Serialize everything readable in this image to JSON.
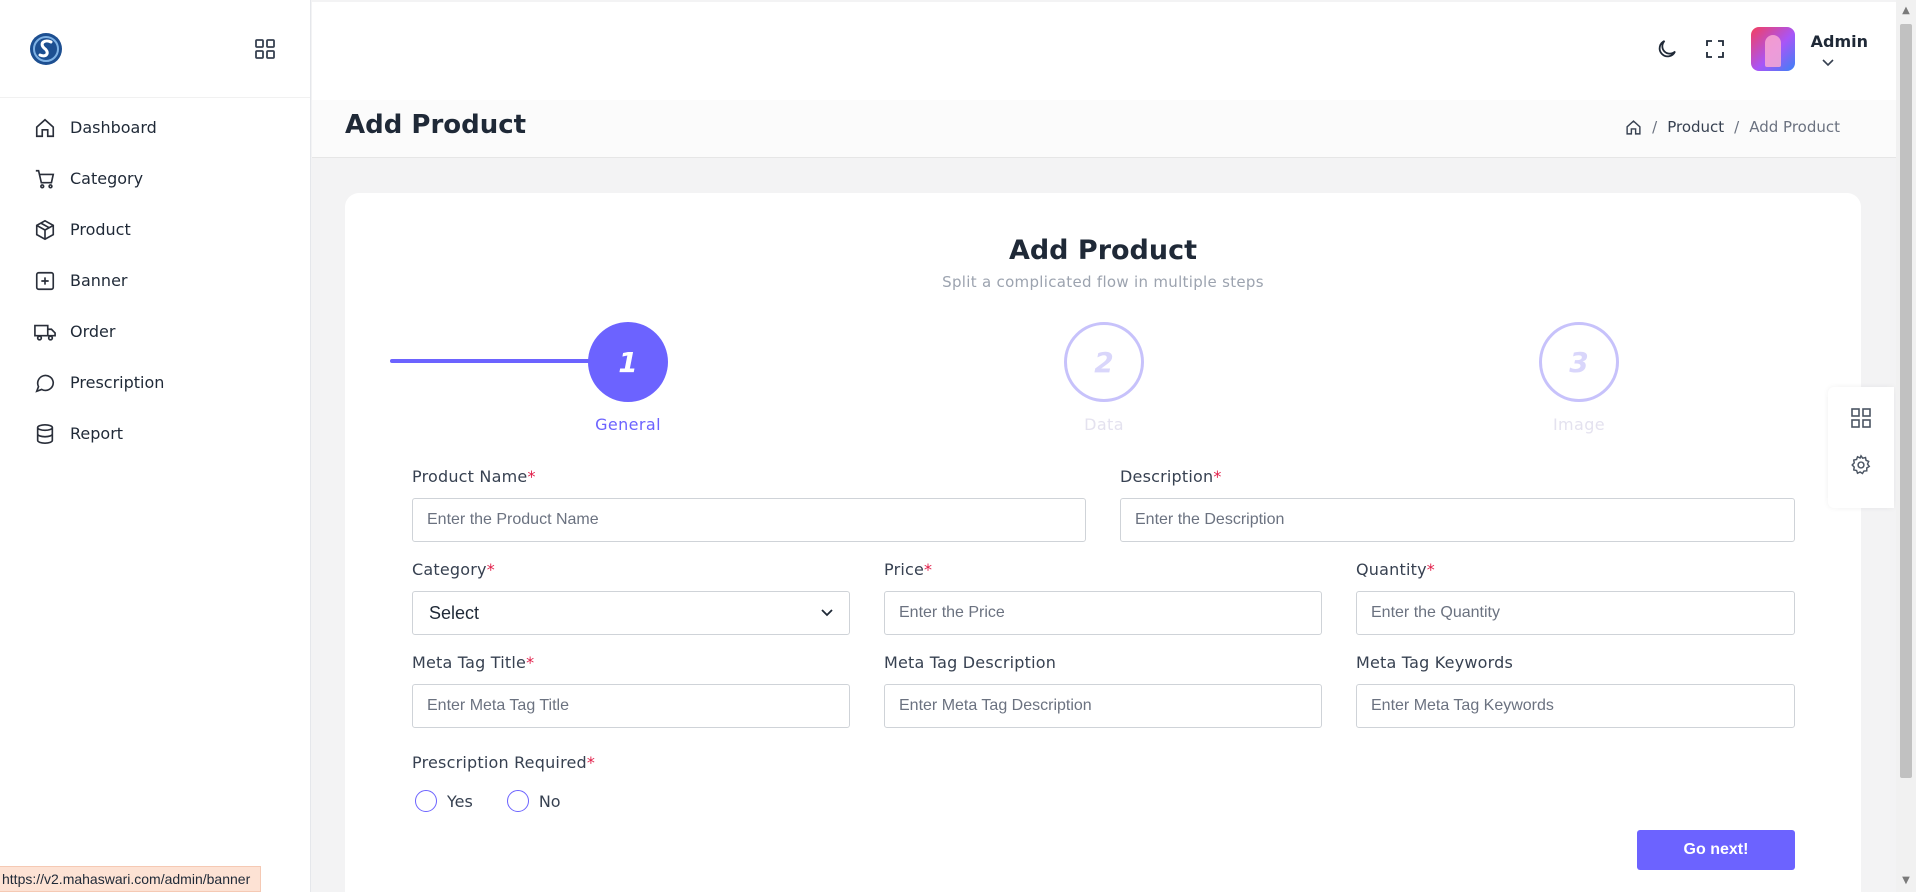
{
  "sidebar": {
    "items": [
      {
        "label": "Dashboard",
        "icon": "home-icon"
      },
      {
        "label": "Category",
        "icon": "cart-icon"
      },
      {
        "label": "Product",
        "icon": "box-icon"
      },
      {
        "label": "Banner",
        "icon": "plus-square-icon"
      },
      {
        "label": "Order",
        "icon": "truck-icon"
      },
      {
        "label": "Prescription",
        "icon": "chat-icon"
      },
      {
        "label": "Report",
        "icon": "database-icon"
      }
    ]
  },
  "topbar": {
    "user_name": "Admin"
  },
  "page": {
    "title": "Add Product",
    "breadcrumb": [
      "Product",
      "Add Product"
    ]
  },
  "form": {
    "title": "Add Product",
    "subtitle": "Split a complicated flow in multiple steps",
    "steps": [
      {
        "number": "1",
        "label": "General",
        "active": true
      },
      {
        "number": "2",
        "label": "Data",
        "active": false
      },
      {
        "number": "3",
        "label": "Image",
        "active": false
      }
    ],
    "fields": {
      "product_name": {
        "label": "Product Name",
        "required": "*",
        "placeholder": "Enter the Product Name"
      },
      "description": {
        "label": "Description",
        "required": "*",
        "placeholder": "Enter the Description"
      },
      "category": {
        "label": "Category",
        "required": "*",
        "value": "Select"
      },
      "price": {
        "label": "Price",
        "required": "*",
        "placeholder": "Enter the Price"
      },
      "quantity": {
        "label": "Quantity",
        "required": "*",
        "placeholder": "Enter the Quantity"
      },
      "meta_title": {
        "label": "Meta Tag Title",
        "required": "*",
        "placeholder": "Enter Meta Tag Title"
      },
      "meta_description": {
        "label": "Meta Tag Description",
        "placeholder": "Enter Meta Tag Description"
      },
      "meta_keywords": {
        "label": "Meta Tag Keywords",
        "placeholder": "Enter Meta Tag Keywords"
      },
      "prescription": {
        "label": "Prescription Required",
        "required": "*",
        "options": [
          "Yes",
          "No"
        ]
      }
    },
    "next_button": "Go next!"
  },
  "status_url": "https://v2.mahaswari.com/admin/banner",
  "colors": {
    "accent": "#6c63ff",
    "required": "#e11d48"
  }
}
